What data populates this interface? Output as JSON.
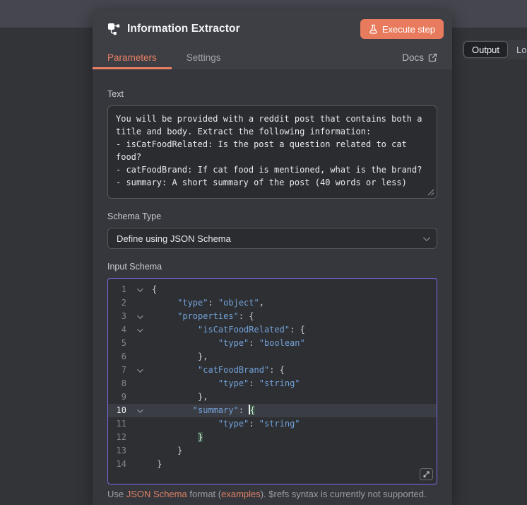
{
  "header": {
    "title": "Information Extractor",
    "execute_button": "Execute step",
    "tabs": {
      "parameters": "Parameters",
      "settings": "Settings"
    },
    "docs_link": "Docs"
  },
  "right_panel_tabs": {
    "output": "Output",
    "logs": "Logs"
  },
  "form": {
    "text": {
      "label": "Text",
      "value": "You will be provided with a reddit post that contains both a title and body. Extract the following information:\n- isCatFoodRelated: Is the post a question related to cat food?\n- catFoodBrand: If cat food is mentioned, what is the brand?\n- summary: A short summary of the post (40 words or less)"
    },
    "schema_type": {
      "label": "Schema Type",
      "value": "Define using JSON Schema"
    },
    "input_schema": {
      "label": "Input Schema"
    },
    "footer": {
      "pre": "Use ",
      "link_json_schema": "JSON Schema",
      "mid": " format (",
      "link_examples": "examples",
      "post": "). $refs syntax is currently not supported."
    }
  },
  "editor": {
    "active_line": 10,
    "lines": [
      {
        "num": 1,
        "fold": true,
        "tokens": [
          [
            "p",
            "{"
          ]
        ]
      },
      {
        "num": 2,
        "fold": false,
        "tokens": [
          [
            "p",
            "     "
          ],
          [
            "s",
            "\"type\""
          ],
          [
            "p",
            ": "
          ],
          [
            "s",
            "\"object\""
          ],
          [
            "p",
            ","
          ]
        ]
      },
      {
        "num": 3,
        "fold": true,
        "tokens": [
          [
            "p",
            "     "
          ],
          [
            "s",
            "\"properties\""
          ],
          [
            "p",
            ": {"
          ]
        ]
      },
      {
        "num": 4,
        "fold": true,
        "tokens": [
          [
            "p",
            "         "
          ],
          [
            "s",
            "\"isCatFoodRelated\""
          ],
          [
            "p",
            ": {"
          ]
        ]
      },
      {
        "num": 5,
        "fold": false,
        "tokens": [
          [
            "p",
            "             "
          ],
          [
            "s",
            "\"type\""
          ],
          [
            "p",
            ": "
          ],
          [
            "s",
            "\"boolean\""
          ]
        ]
      },
      {
        "num": 6,
        "fold": false,
        "tokens": [
          [
            "p",
            "         },"
          ]
        ]
      },
      {
        "num": 7,
        "fold": true,
        "tokens": [
          [
            "p",
            "         "
          ],
          [
            "s",
            "\"catFoodBrand\""
          ],
          [
            "p",
            ": {"
          ]
        ]
      },
      {
        "num": 8,
        "fold": false,
        "tokens": [
          [
            "p",
            "             "
          ],
          [
            "s",
            "\"type\""
          ],
          [
            "p",
            ": "
          ],
          [
            "s",
            "\"string\""
          ]
        ]
      },
      {
        "num": 9,
        "fold": false,
        "tokens": [
          [
            "p",
            "         },"
          ]
        ]
      },
      {
        "num": 10,
        "fold": true,
        "tokens": [
          [
            "p",
            "        "
          ],
          [
            "s",
            "\"summary\""
          ],
          [
            "p",
            ": "
          ],
          [
            "cur",
            ""
          ],
          [
            "m",
            "{"
          ]
        ]
      },
      {
        "num": 11,
        "fold": false,
        "tokens": [
          [
            "p",
            "             "
          ],
          [
            "s",
            "\"type\""
          ],
          [
            "p",
            ": "
          ],
          [
            "s",
            "\"string\""
          ]
        ]
      },
      {
        "num": 12,
        "fold": false,
        "tokens": [
          [
            "p",
            "         "
          ],
          [
            "m",
            "}"
          ]
        ]
      },
      {
        "num": 13,
        "fold": false,
        "tokens": [
          [
            "p",
            "     }"
          ]
        ]
      },
      {
        "num": 14,
        "fold": false,
        "tokens": [
          [
            "p",
            " }"
          ]
        ]
      }
    ]
  },
  "colors": {
    "accent_orange": "#e87b5e",
    "link_orange": "#e07f66",
    "code_string_blue": "#73a1d7",
    "bracket_match_green": "#3c5448",
    "editor_focus_border": "#756ae4",
    "top_band": "#45464e",
    "page_bg": "#333438",
    "panel_bg": "#35373c",
    "panel_header_bg": "#3d3f45"
  }
}
